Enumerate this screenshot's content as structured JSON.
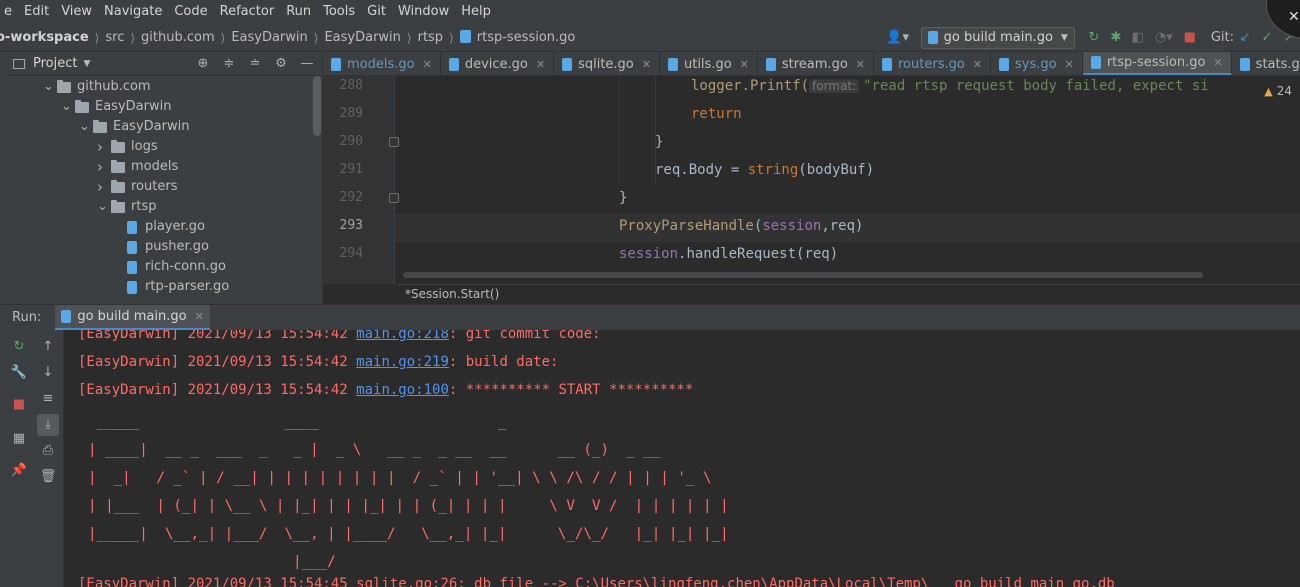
{
  "menu": [
    "e",
    "Edit",
    "View",
    "Navigate",
    "Code",
    "Refactor",
    "Run",
    "Tools",
    "Git",
    "Window",
    "Help"
  ],
  "breadcrumb": {
    "root": "o-workspace",
    "parts": [
      "src",
      "github.com",
      "EasyDarwin",
      "EasyDarwin",
      "rtsp"
    ],
    "file": "rtsp-session.go"
  },
  "toolbar": {
    "run_config": "go build main.go",
    "git_label": "Git:"
  },
  "project": {
    "title": "Project",
    "tree": [
      {
        "label": "github.com",
        "type": "folder",
        "depth": 0,
        "expanded": true
      },
      {
        "label": "EasyDarwin",
        "type": "folder",
        "depth": 1,
        "expanded": true
      },
      {
        "label": "EasyDarwin",
        "type": "folder",
        "depth": 2,
        "expanded": true
      },
      {
        "label": "logs",
        "type": "folder",
        "depth": 3,
        "expanded": false
      },
      {
        "label": "models",
        "type": "folder",
        "depth": 3,
        "expanded": false
      },
      {
        "label": "routers",
        "type": "folder",
        "depth": 3,
        "expanded": false
      },
      {
        "label": "rtsp",
        "type": "folder",
        "depth": 3,
        "expanded": true
      },
      {
        "label": "player.go",
        "type": "file",
        "depth": 4
      },
      {
        "label": "pusher.go",
        "type": "file",
        "depth": 4
      },
      {
        "label": "rich-conn.go",
        "type": "file",
        "depth": 4
      },
      {
        "label": "rtp-parser.go",
        "type": "file",
        "depth": 4
      }
    ]
  },
  "editor_tabs": [
    {
      "label": "models.go",
      "active": false,
      "blue": true
    },
    {
      "label": "device.go",
      "active": false,
      "blue": false
    },
    {
      "label": "sqlite.go",
      "active": false,
      "blue": false
    },
    {
      "label": "utils.go",
      "active": false,
      "blue": false
    },
    {
      "label": "stream.go",
      "active": false,
      "blue": false
    },
    {
      "label": "routers.go",
      "active": false,
      "blue": true
    },
    {
      "label": "sys.go",
      "active": false,
      "blue": true
    },
    {
      "label": "rtsp-session.go",
      "active": true,
      "blue": false
    },
    {
      "label": "stats.go",
      "active": false,
      "blue": false
    }
  ],
  "editor": {
    "warning_count": "24",
    "lines": [
      {
        "no": "288",
        "indent": 2
      },
      {
        "no": "289",
        "indent": 2
      },
      {
        "no": "290",
        "indent": 1
      },
      {
        "no": "291",
        "indent": 1
      },
      {
        "no": "292",
        "indent": 0
      },
      {
        "no": "293",
        "indent": 0
      },
      {
        "no": "294",
        "indent": 0
      }
    ],
    "code": {
      "l288_call": "logger.Printf(",
      "l288_hint": "format:",
      "l288_str": "\"read rtsp request body failed, expect si",
      "l289": "return",
      "l290": "}",
      "l291_a": "req.Body = ",
      "l291_fn": "string",
      "l291_b": "(bodyBuf)",
      "l292": "}",
      "l293_fn": "ProxyParseHandle",
      "l293_a": "(",
      "l293_sess": "session",
      "l293_b": ",req)",
      "l294_sess": "session",
      "l294_b": ".handleRequest(req)"
    },
    "function_breadcrumb": "*Session.Start()"
  },
  "run": {
    "label": "Run:",
    "tab": "go build main.go",
    "log": [
      {
        "prefix": "[EasyDarwin] 2021/09/13 15:54:42 ",
        "link": "main.go:218",
        "msg": ": git commit code:"
      },
      {
        "prefix": "[EasyDarwin] 2021/09/13 15:54:42 ",
        "link": "main.go:219",
        "msg": ": build date:"
      },
      {
        "prefix": "[EasyDarwin] 2021/09/13 15:54:42 ",
        "link": "main.go:100",
        "msg": ": ********** START **********"
      }
    ],
    "ascii": [
      " _____                 ____                     _",
      "| ____|  __ _  ___  _   _ |  _ \\   __ _  _ __  __      __ (_)  _ __",
      "|  _|   / _` | / __| | | | | | | | |  / _` | | '__| \\ \\ /\\ / / | | | '_ \\",
      "| |___  | (_| | \\__ \\ | |_| | | |_| | | (_| | | |     \\ V  V /  | | | | | |",
      "|_____|  \\__,_| |___/  \\__, | |____/   \\__,_| |_|      \\_/\\_/   |_| |_| |_|",
      "                        |___/"
    ],
    "last_line": "[EasyDarwin] 2021/09/13 15:54:45 sqlite.go:26: db file --> C:\\Users\\lingfeng.chen\\AppData\\Local\\Temp\\___go_build_main_go.db"
  }
}
